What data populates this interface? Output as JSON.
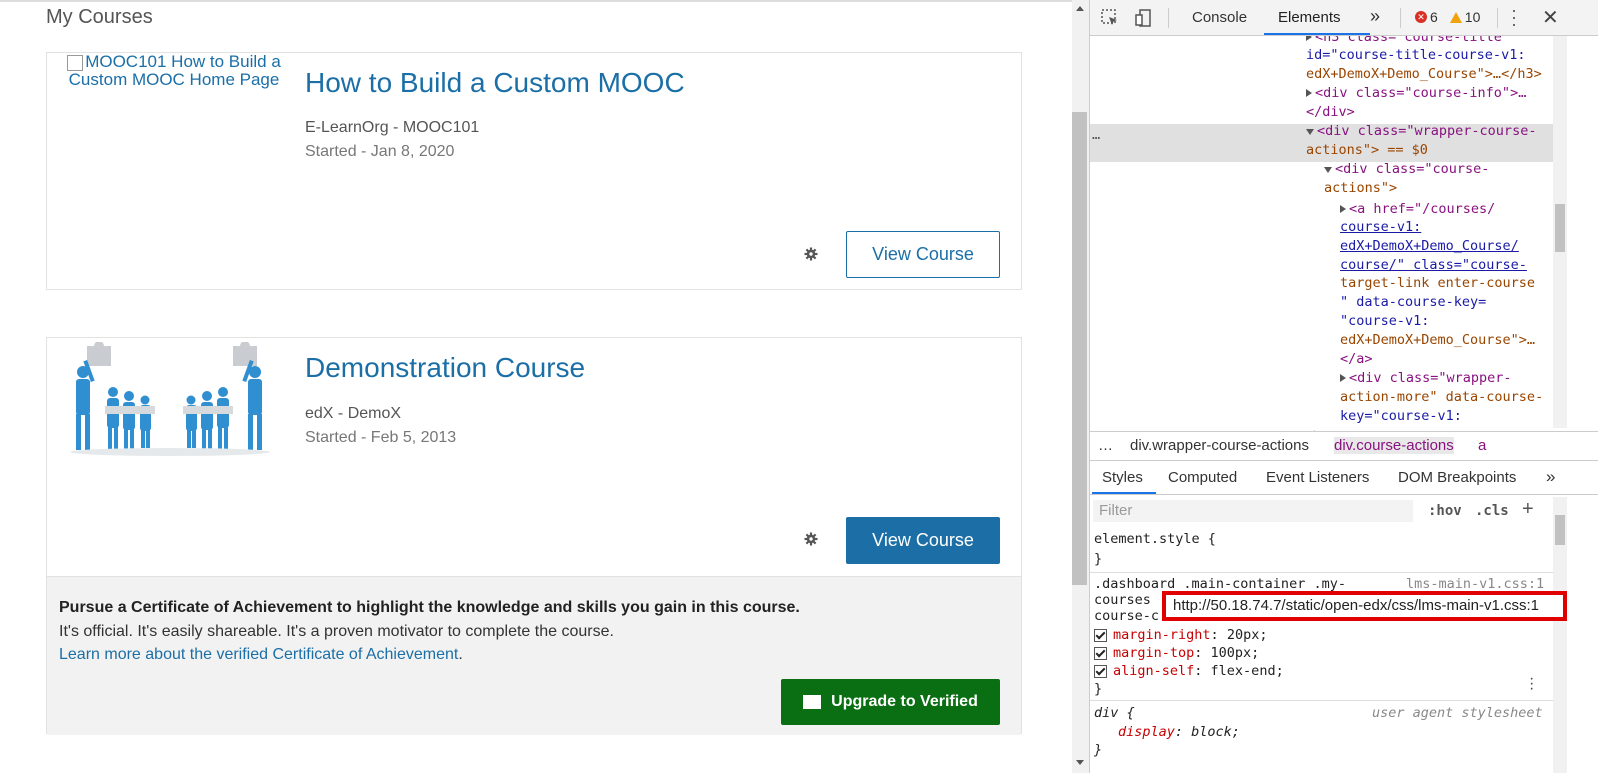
{
  "page": {
    "title": "My Courses",
    "courses": [
      {
        "image_alt": "MOOC101 How to Build a Custom MOOC Home Page",
        "title": "How to Build a Custom MOOC",
        "org": "E-LearnOrg - MOOC101",
        "started": "Started - Jan 8, 2020",
        "view_label": "View Course"
      },
      {
        "title": "Demonstration Course",
        "org": "edX - DemoX",
        "started": "Started - Feb 5, 2013",
        "view_label": "View Course",
        "cert_heading": "Pursue a Certificate of Achievement to highlight the knowledge and skills you gain in this course.",
        "cert_sub": "It's official. It's easily shareable. It's a proven motivator to complete the course.",
        "cert_link": "Learn more about the verified Certificate of Achievement",
        "cert_link_suffix": ".",
        "upgrade_label": "Upgrade to Verified"
      }
    ]
  },
  "devtools": {
    "tabs": [
      "Console",
      "Elements"
    ],
    "active_tab": "Elements",
    "more_tabs": "»",
    "errors": "6",
    "warnings": "10",
    "dom": [
      {
        "a": "▸",
        "b": "<h3 class=\"course-title\""
      },
      {
        "a": "",
        "b": "id=\"course-title-course-v1:"
      },
      {
        "a": "",
        "b": "edX+DemoX+Demo_Course\">…</h3>"
      },
      {
        "a": "▸",
        "b": "<div class=\"course-info\">…"
      },
      {
        "a": "",
        "b": "</div>"
      },
      {
        "a": "▾",
        "b": "<div class=\"wrapper-course-"
      },
      {
        "a": "",
        "b": "actions\"> == $0"
      },
      {
        "a": "▾",
        "b": "<div class=\"course-"
      },
      {
        "a": "",
        "b": "actions\">"
      },
      {
        "a": "▸",
        "b": "<a href=\"/courses/"
      },
      {
        "a": "",
        "b": "course-v1:"
      },
      {
        "a": "",
        "b": "edX+DemoX+Demo_Course/"
      },
      {
        "a": "",
        "b": "course/\" class=\"course-"
      },
      {
        "a": "",
        "b": "target-link enter-course"
      },
      {
        "a": "",
        "b": "\" data-course-key="
      },
      {
        "a": "",
        "b": "\"course-v1:"
      },
      {
        "a": "",
        "b": "edX+DemoX+Demo_Course\">…"
      },
      {
        "a": "",
        "b": "</a>"
      },
      {
        "a": "▸",
        "b": "<div class=\"wrapper-"
      },
      {
        "a": "",
        "b": "action-more\" data-course-"
      },
      {
        "a": "",
        "b": "key=\"course-v1:"
      }
    ],
    "dom_ellipsis": "…",
    "breadcrumbs": [
      "…",
      "div.wrapper-course-actions",
      "div.course-actions",
      "a"
    ],
    "styles_tabs": [
      "Styles",
      "Computed",
      "Event Listeners",
      "DOM Breakpoints",
      "»"
    ],
    "filter_placeholder": "Filter",
    "hov": ":hov",
    "cls": ".cls",
    "plus": "+",
    "css": {
      "element_style_open": "element.style {",
      "element_style_close": "}",
      "rule_selector_1": ".dashboard .main-container .my-",
      "rule_selector_2": "courses",
      "rule_selector_3": "course-c",
      "rule_source": "lms-main-v1.css:1",
      "props": [
        {
          "name": "margin-right",
          "value": "20px;"
        },
        {
          "name": "margin-top",
          "value": "100px;"
        },
        {
          "name": "align-self",
          "value": "flex-end;"
        }
      ],
      "rule_close": "}",
      "ua_selector": "div {",
      "ua_source": "user agent stylesheet",
      "ua_prop_name": "display",
      "ua_prop_value": "block;",
      "ua_close": "}"
    },
    "tooltip": "http://50.18.74.7/static/open-edx/css/lms-main-v1.css:1"
  },
  "colors": {
    "link": "#1b6fa6",
    "upgrade_green": "#0a6e12",
    "devtools_accent": "#1a73e8",
    "highlight_red": "#e00000"
  }
}
